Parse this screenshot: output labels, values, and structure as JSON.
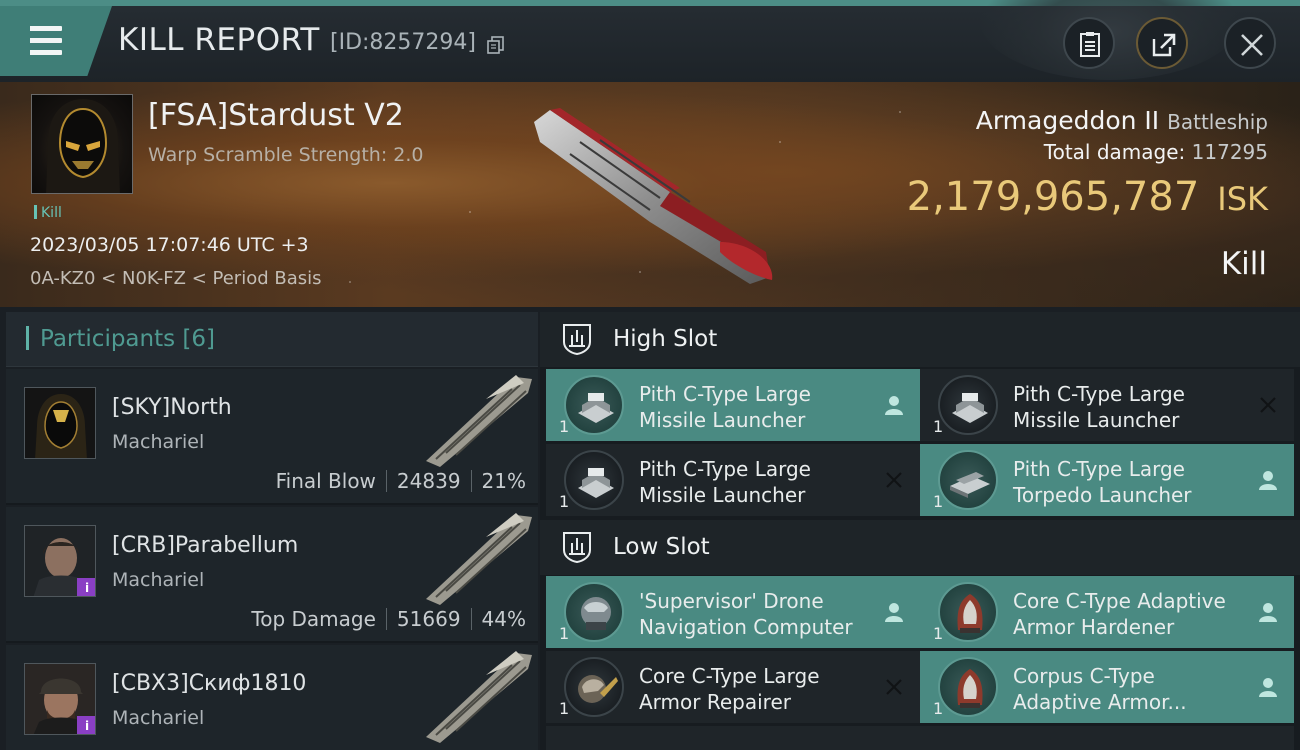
{
  "header": {
    "title": "KILL REPORT",
    "report_id": "[ID:8257294]",
    "icons": [
      "menu-icon",
      "copy-icon",
      "clipboard-icon",
      "share-icon",
      "close-icon"
    ]
  },
  "victim": {
    "name": "[FSA]Stardust V2",
    "warp_scramble": "Warp Scramble Strength: 2.0",
    "tag": "Kill",
    "datetime": "2023/03/05 17:07:46 UTC +3",
    "location": "0A-KZ0 < N0K-FZ < Period Basis",
    "ship_name": "Armageddon II",
    "ship_class": "Battleship",
    "total_damage_label": "Total damage:",
    "total_damage": "117295",
    "isk_value": "2,179,965,787",
    "isk_unit": "ISK",
    "result": "Kill"
  },
  "participants": {
    "title": "Participants",
    "count": "[6]",
    "rows": [
      {
        "name": "[SKY]North",
        "ship": "Machariel",
        "role": "Final Blow",
        "damage": "24839",
        "percent": "21%"
      },
      {
        "name": "[CRB]Parabellum",
        "ship": "Machariel",
        "role": "Top Damage",
        "damage": "51669",
        "percent": "44%"
      },
      {
        "name": "[CBX3]Скиф1810",
        "ship": "Machariel",
        "role": "",
        "damage": "",
        "percent": ""
      }
    ]
  },
  "fitting": {
    "high_slot_label": "High Slot",
    "low_slot_label": "Low Slot",
    "high": [
      {
        "line1": "Pith C-Type Large",
        "line2": "Missile Launcher",
        "qty": "1",
        "status": "dropped"
      },
      {
        "line1": "Pith C-Type Large",
        "line2": "Missile Launcher",
        "qty": "1",
        "status": "destroyed"
      },
      {
        "line1": "Pith C-Type Large",
        "line2": "Missile Launcher",
        "qty": "1",
        "status": "destroyed"
      },
      {
        "line1": "Pith C-Type Large",
        "line2": "Torpedo Launcher",
        "qty": "1",
        "status": "dropped"
      }
    ],
    "low": [
      {
        "line1": "'Supervisor' Drone",
        "line2": "Navigation Computer",
        "qty": "1",
        "status": "dropped"
      },
      {
        "line1": "Core C-Type Adaptive",
        "line2": " Armor Hardener",
        "qty": "1",
        "status": "dropped"
      },
      {
        "line1": "Core C-Type Large",
        "line2": "Armor Repairer",
        "qty": "1",
        "status": "destroyed"
      },
      {
        "line1": "Corpus C-Type",
        "line2": "Adaptive Armor...",
        "qty": "1",
        "status": "dropped"
      }
    ]
  },
  "colors": {
    "accent": "#4a8a82",
    "isk": "#e9c97a",
    "participants_title": "#4f9a91"
  }
}
